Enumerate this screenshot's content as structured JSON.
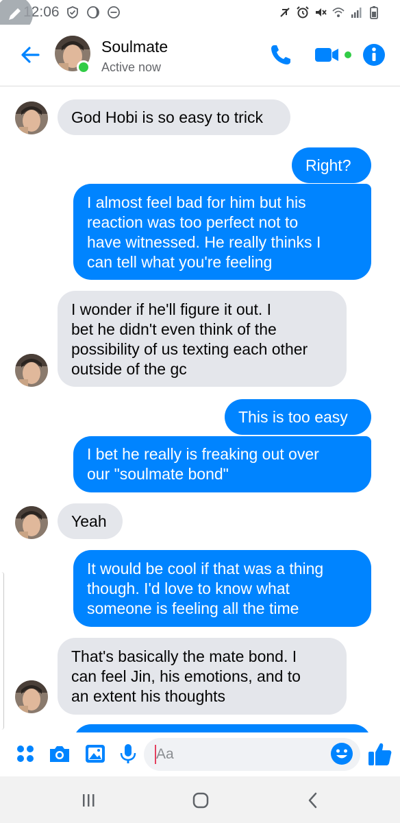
{
  "status_bar": {
    "time": "12:06",
    "left_icons": [
      "shield-check-icon",
      "moon-icon",
      "do-not-disturb-icon"
    ],
    "right_icons": [
      "no-sound-icon",
      "alarm-icon",
      "mute-icon",
      "wifi-icon",
      "signal-icon",
      "battery-icon"
    ]
  },
  "header": {
    "name": "Soulmate",
    "status": "Active now",
    "active_color": "#31cc46"
  },
  "theme": {
    "accent": "#0084ff",
    "incoming_bubble": "#e4e6eb"
  },
  "messages": [
    {
      "dir": "in",
      "avatar": true,
      "lines": [
        "God Hobi is so easy to trick"
      ]
    },
    {
      "dir": "out",
      "lines": [
        "Right?"
      ]
    },
    {
      "dir": "out",
      "lines": [
        "I almost feel bad for him but his",
        "reaction was too perfect not to",
        "have witnessed. He really thinks I",
        "can tell what you're feeling"
      ]
    },
    {
      "dir": "in",
      "avatar": true,
      "lines": [
        "I wonder if he'll figure it out. I",
        "bet he didn't even think of the",
        "possibility of us texting each other",
        "outside of the gc"
      ]
    },
    {
      "dir": "out",
      "lines": [
        "This is too easy"
      ]
    },
    {
      "dir": "out",
      "lines": [
        "I bet he really is freaking out over",
        "our \"soulmate bond\""
      ]
    },
    {
      "dir": "in",
      "avatar": true,
      "lines": [
        "Yeah"
      ]
    },
    {
      "dir": "out",
      "lines": [
        "It would be cool if that was a thing",
        "though. I'd love to know what",
        "someone is feeling all the time"
      ]
    },
    {
      "dir": "in",
      "avatar": true,
      "lines": [
        "That's basically the mate bond. I",
        "can feel Jin, his emotions, and to",
        "an extent his thoughts"
      ]
    },
    {
      "dir": "out",
      "lines": [
        ""
      ]
    }
  ],
  "composer": {
    "placeholder": "Aa",
    "icons": [
      "apps-icon",
      "camera-icon",
      "gallery-icon",
      "microphone-icon",
      "emoji-icon",
      "thumbs-up-icon"
    ]
  },
  "nav_bar": {
    "icons": [
      "recent-apps-icon",
      "home-icon",
      "back-icon"
    ]
  }
}
